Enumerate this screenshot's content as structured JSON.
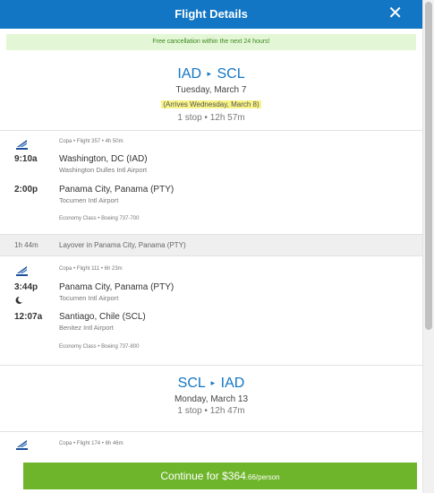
{
  "header": {
    "title": "Flight Details",
    "close_label": "✕"
  },
  "notice": "Free cancellation within the next 24 hours!",
  "outbound": {
    "from": "IAD",
    "to": "SCL",
    "arrow": "▸",
    "date": "Tuesday, March 7",
    "arrives": "(Arrives Wednesday, March 8)",
    "stops": "1 stop • 12h 57m",
    "segments": [
      {
        "meta": "Copa • Flight 357 • 4h 50m",
        "dep_time": "9:10a",
        "dep_city": "Washington, DC (IAD)",
        "dep_airport": "Washington Dulles Intl Airport",
        "arr_time": "2:00p",
        "arr_city": "Panama City, Panama (PTY)",
        "arr_airport": "Tocumen Intl Airport",
        "cabin": "Economy Class • Boeing 737-700"
      },
      {
        "meta": "Copa • Flight 111 • 6h 23m",
        "dep_time": "3:44p",
        "dep_city": "Panama City, Panama (PTY)",
        "dep_airport": "Tocumen Intl Airport",
        "arr_time": "12:07a",
        "arr_city": "Santiago, Chile (SCL)",
        "arr_airport": "Benitez Intl Airport",
        "cabin": "Economy Class • Boeing 737-800"
      }
    ],
    "layover": {
      "duration": "1h 44m",
      "text": "Layover in Panama City, Panama (PTY)"
    }
  },
  "return": {
    "from": "SCL",
    "to": "IAD",
    "arrow": "▸",
    "date": "Monday, March 13",
    "stops": "1 stop • 12h 47m",
    "segments": [
      {
        "meta": "Copa • Flight 174 • 6h 46m"
      }
    ]
  },
  "cta": {
    "prefix": "Continue for $364",
    "cents": ".66/person"
  },
  "colors": {
    "header": "#1276c4",
    "cta": "#6fb52c",
    "notice_bg": "#e3f6d6",
    "highlight": "#f8f488"
  }
}
